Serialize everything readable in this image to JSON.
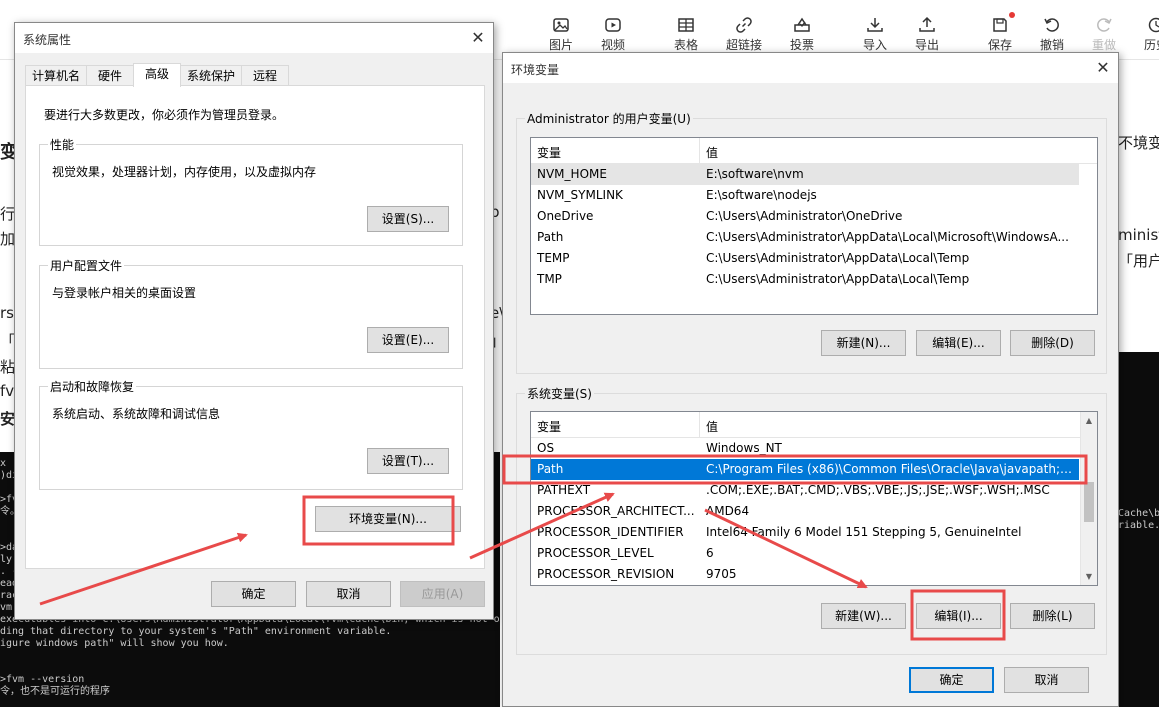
{
  "toolbar": {
    "items": [
      {
        "label": "图片",
        "icon": "image-icon"
      },
      {
        "label": "视频",
        "icon": "video-icon"
      },
      {
        "label": "表格",
        "icon": "table-icon"
      },
      {
        "label": "超链接",
        "icon": "link-icon"
      },
      {
        "label": "投票",
        "icon": "vote-icon"
      },
      {
        "label": "导入",
        "icon": "import-icon"
      },
      {
        "label": "导出",
        "icon": "export-icon"
      },
      {
        "label": "保存",
        "icon": "save-icon"
      },
      {
        "label": "撤销",
        "icon": "undo-icon"
      },
      {
        "label": "重做",
        "icon": "redo-icon"
      },
      {
        "label": "历史",
        "icon": "history-icon"
      }
    ]
  },
  "background_text": {
    "left": [
      "变",
      "行",
      "加到",
      "rs\\",
      "「J",
      "粘贝",
      "fvr",
      "安装"
    ],
    "mid": [
      "p",
      "e\\",
      "」"
    ],
    "right": [
      "不境变",
      "ministr",
      "「用户"
    ]
  },
  "terminal_left": [
    "x",
    ")dir",
    "",
    ">fvm",
    "令。",
    "",
    ">da",
    "ly",
    ". -",
    "ead",
    "rac",
    "vm.",
    "executables into C:\\Users\\Administrator\\AppData\\Local\\fvm\\cache\\bin, which is not on",
    "ding that directory to your system's \"Path\" environment variable.",
    "igure windows path\" will show you how.",
    "",
    ">fvm --version",
    "令，也不是可运行的程序"
  ],
  "terminal_right": [
    "Cache\\b",
    "riable."
  ],
  "sys_props": {
    "title": "系统属性",
    "tabs": [
      "计算机名",
      "硬件",
      "高级",
      "系统保护",
      "远程"
    ],
    "notice": "要进行大多数更改，你必须作为管理员登录。",
    "performance": {
      "title": "性能",
      "desc": "视觉效果，处理器计划，内存使用，以及虚拟内存",
      "button": "设置(S)..."
    },
    "user_profiles": {
      "title": "用户配置文件",
      "desc": "与登录帐户相关的桌面设置",
      "button": "设置(E)..."
    },
    "startup": {
      "title": "启动和故障恢复",
      "desc": "系统启动、系统故障和调试信息",
      "button": "设置(T)..."
    },
    "env_button": "环境变量(N)...",
    "ok": "确定",
    "cancel": "取消",
    "apply": "应用(A)"
  },
  "env_vars": {
    "title": "环境变量",
    "user_group_title": "Administrator 的用户变量(U)",
    "columns": {
      "var": "变量",
      "val": "值"
    },
    "user_vars": [
      {
        "name": "NVM_HOME",
        "value": "E:\\software\\nvm"
      },
      {
        "name": "NVM_SYMLINK",
        "value": "E:\\software\\nodejs"
      },
      {
        "name": "OneDrive",
        "value": "C:\\Users\\Administrator\\OneDrive"
      },
      {
        "name": "Path",
        "value": "C:\\Users\\Administrator\\AppData\\Local\\Microsoft\\WindowsA..."
      },
      {
        "name": "TEMP",
        "value": "C:\\Users\\Administrator\\AppData\\Local\\Temp"
      },
      {
        "name": "TMP",
        "value": "C:\\Users\\Administrator\\AppData\\Local\\Temp"
      }
    ],
    "user_buttons": {
      "new": "新建(N)...",
      "edit": "编辑(E)...",
      "delete": "删除(D)"
    },
    "sys_group_title": "系统变量(S)",
    "sys_vars": [
      {
        "name": "OS",
        "value": "Windows_NT"
      },
      {
        "name": "Path",
        "value": "C:\\Program Files (x86)\\Common Files\\Oracle\\Java\\javapath;C:..."
      },
      {
        "name": "PATHEXT",
        "value": ".COM;.EXE;.BAT;.CMD;.VBS;.VBE;.JS;.JSE;.WSF;.WSH;.MSC"
      },
      {
        "name": "PROCESSOR_ARCHITECT...",
        "value": "AMD64"
      },
      {
        "name": "PROCESSOR_IDENTIFIER",
        "value": "Intel64 Family 6 Model 151 Stepping 5, GenuineIntel"
      },
      {
        "name": "PROCESSOR_LEVEL",
        "value": "6"
      },
      {
        "name": "PROCESSOR_REVISION",
        "value": "9705"
      }
    ],
    "sys_buttons": {
      "new": "新建(W)...",
      "edit": "编辑(I)...",
      "delete": "删除(L)"
    },
    "ok": "确定",
    "cancel": "取消"
  },
  "colors": {
    "annotation": "#e84a4a",
    "selection": "#0078d7",
    "dialog_bg": "#f0f0f0"
  }
}
